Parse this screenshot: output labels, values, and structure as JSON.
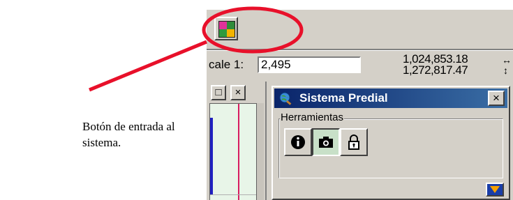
{
  "caption": {
    "line1": "Botón de entrada al",
    "line2": "sistema."
  },
  "toolbar": {
    "system_button_icon": "four-color-grid-icon"
  },
  "scale": {
    "label": "cale 1:",
    "value": "2,495"
  },
  "coordinates": {
    "x": "1,024,853.18",
    "y": "1,272,817.47"
  },
  "left_window": {
    "maximize_glyph": "□",
    "close_glyph": "×"
  },
  "panel": {
    "title": "Sistema Predial",
    "close_glyph": "×",
    "group_label": "Herramientas",
    "tools": [
      {
        "name": "info-icon"
      },
      {
        "name": "camera-icon"
      },
      {
        "name": "lock-icon"
      }
    ]
  },
  "colors": {
    "highlight": "#e8102a",
    "titlebar": "#0a246a",
    "grid_colors": [
      "#e0329a",
      "#2e8b3a",
      "#2f9a3e",
      "#f2b400"
    ],
    "expand_arrow": "#f5a000"
  }
}
